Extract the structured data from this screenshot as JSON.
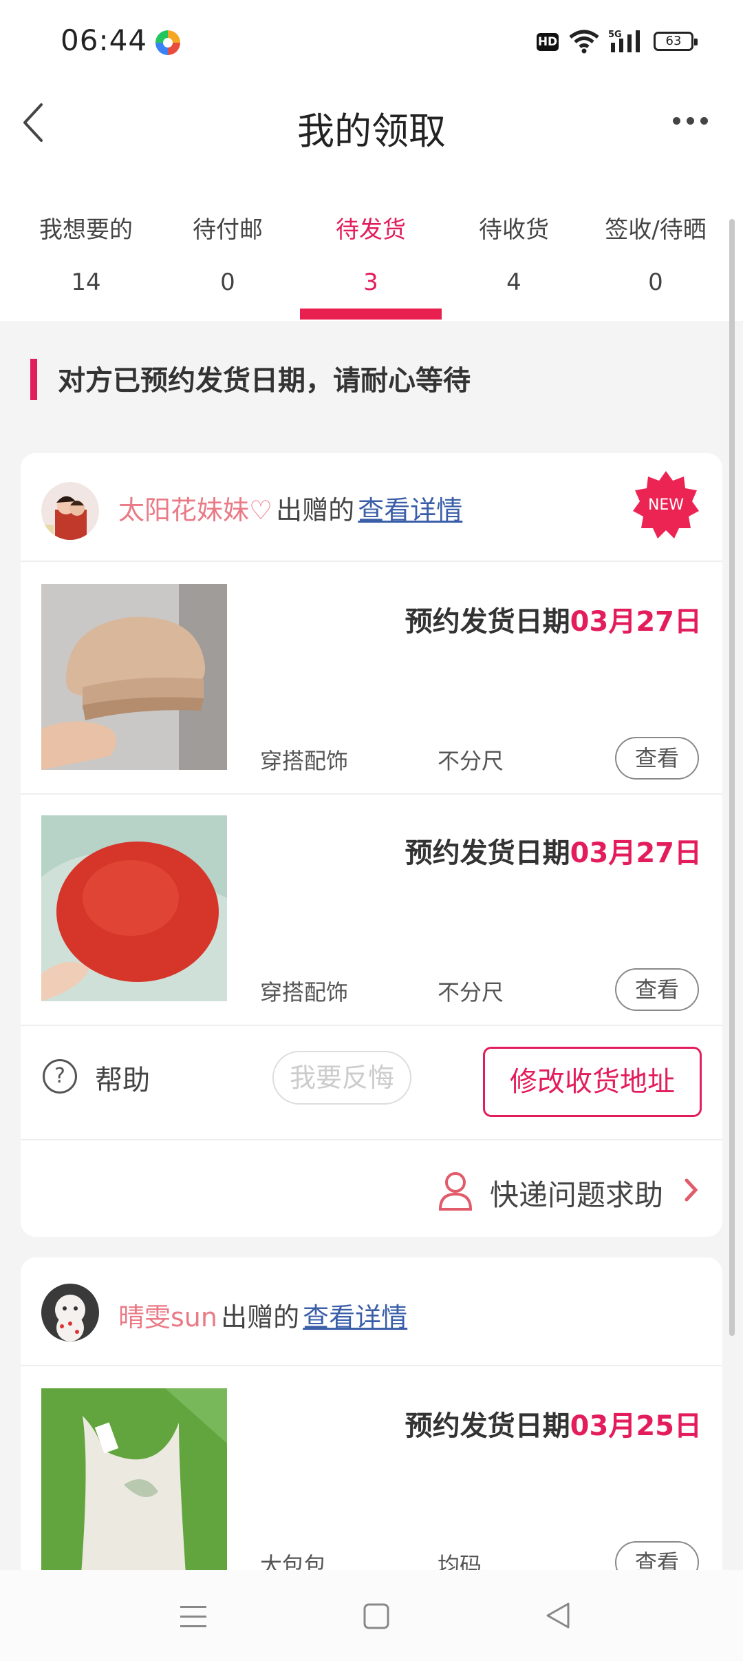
{
  "status_bar": {
    "time": "06:44",
    "hd": "HD",
    "network": "5G",
    "battery": "63"
  },
  "header": {
    "title": "我的领取"
  },
  "tabs": [
    {
      "label": "我想要的",
      "count": "14"
    },
    {
      "label": "待付邮",
      "count": "0"
    },
    {
      "label": "待发货",
      "count": "3"
    },
    {
      "label": "待收货",
      "count": "4"
    },
    {
      "label": "签收/待晒",
      "count": "0"
    }
  ],
  "active_tab": "待发货",
  "notice": "对方已预约发货日期，请耐心等待",
  "orders": [
    {
      "seller": "太阳花妹妹♡",
      "verb": "出赠的",
      "detail_link": "查看详情",
      "badge": "NEW",
      "items": [
        {
          "ship_label": "预约发货日期",
          "ship_date": "03月27日",
          "category": "穿搭配饰",
          "size": "不分尺",
          "view_label": "查看"
        },
        {
          "ship_label": "预约发货日期",
          "ship_date": "03月27日",
          "category": "穿搭配饰",
          "size": "不分尺",
          "view_label": "查看"
        }
      ],
      "help_label": "帮助",
      "regret_label": "我要反悔",
      "modify_address_label": "修改收货地址",
      "express_help_label": "快递问题求助"
    },
    {
      "seller": "晴雯sun",
      "verb": "出赠的",
      "detail_link": "查看详情",
      "items": [
        {
          "ship_label": "预约发货日期",
          "ship_date": "03月25日",
          "category": "大包包",
          "size": "均码",
          "view_label": "查看"
        }
      ]
    }
  ],
  "colors": {
    "accent": "#e31d5c",
    "seller_name": "#e97a86",
    "link": "#3a5fa8"
  }
}
